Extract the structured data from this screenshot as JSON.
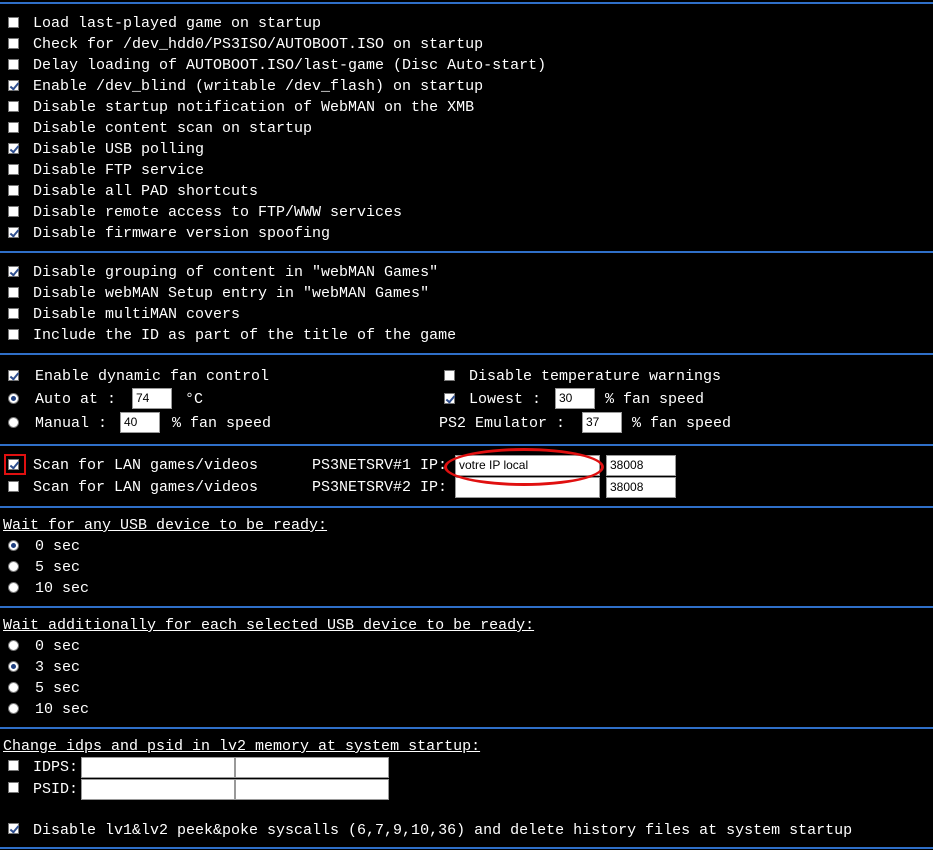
{
  "section1": [
    {
      "label": "Load last-played game on startup",
      "checked": false
    },
    {
      "label": "Check for /dev_hdd0/PS3ISO/AUTOBOOT.ISO on startup",
      "checked": false
    },
    {
      "label": "Delay loading of AUTOBOOT.ISO/last-game (Disc Auto-start)",
      "checked": false
    },
    {
      "label": "Enable /dev_blind (writable /dev_flash) on startup",
      "checked": true
    },
    {
      "label": "Disable startup notification of WebMAN on the XMB",
      "checked": false
    },
    {
      "label": "Disable content scan on startup",
      "checked": false
    },
    {
      "label": "Disable USB polling",
      "checked": true
    },
    {
      "label": "Disable FTP service",
      "checked": false
    },
    {
      "label": "Disable all PAD shortcuts",
      "checked": false
    },
    {
      "label": "Disable remote access to FTP/WWW services",
      "checked": false
    },
    {
      "label": "Disable firmware version spoofing",
      "checked": true
    }
  ],
  "section2": [
    {
      "label": "Disable grouping of content in \"webMAN Games\"",
      "checked": true
    },
    {
      "label": "Disable webMAN Setup entry in \"webMAN Games\"",
      "checked": false
    },
    {
      "label": "Disable multiMAN covers",
      "checked": false
    },
    {
      "label": "Include the ID as part of the title of the game",
      "checked": false
    }
  ],
  "fan": {
    "dynamic_label": "Enable dynamic fan control",
    "dynamic_checked": true,
    "auto_label": "Auto at :",
    "auto_value": "74",
    "auto_unit": "°C",
    "auto_selected": true,
    "manual_label": "Manual :",
    "manual_value": "40",
    "manual_unit": "% fan speed",
    "disable_temp_label": "Disable temperature warnings",
    "disable_temp_checked": false,
    "lowest_label": "Lowest :",
    "lowest_value": "30",
    "lowest_unit": "% fan speed",
    "lowest_checked": true,
    "ps2_label": "PS2 Emulator :",
    "ps2_value": "37",
    "ps2_unit": "% fan speed"
  },
  "lan": [
    {
      "label": "Scan for LAN games/videos",
      "server": "PS3NETSRV#1 IP:",
      "ip": "votre IP local",
      "port": "38008",
      "checked": true
    },
    {
      "label": "Scan for LAN games/videos",
      "server": "PS3NETSRV#2 IP:",
      "ip": "",
      "port": "38008",
      "checked": false
    }
  ],
  "usb_wait": {
    "heading": "Wait for any USB device to be ready:",
    "options": [
      {
        "label": "0 sec",
        "selected": true
      },
      {
        "label": "5 sec",
        "selected": false
      },
      {
        "label": "10 sec",
        "selected": false
      }
    ]
  },
  "usb_wait_additional": {
    "heading": "Wait additionally for each selected USB device to be ready:",
    "options": [
      {
        "label": "0 sec",
        "selected": false
      },
      {
        "label": "3 sec",
        "selected": true
      },
      {
        "label": "5 sec",
        "selected": false
      },
      {
        "label": "10 sec",
        "selected": false
      }
    ]
  },
  "idps": {
    "heading": "Change idps and psid in lv2 memory at system startup:",
    "idps_label": "IDPS:",
    "psid_label": "PSID:",
    "idps_checked": false,
    "psid_checked": false
  },
  "peekpoke": {
    "label": "Disable lv1&lv2 peek&poke syscalls (6,7,9,10,36) and delete history files at system startup",
    "checked": true
  },
  "colors": {
    "background": "#000000",
    "separator": "#2f6fc8",
    "annotation": "#e01010"
  }
}
